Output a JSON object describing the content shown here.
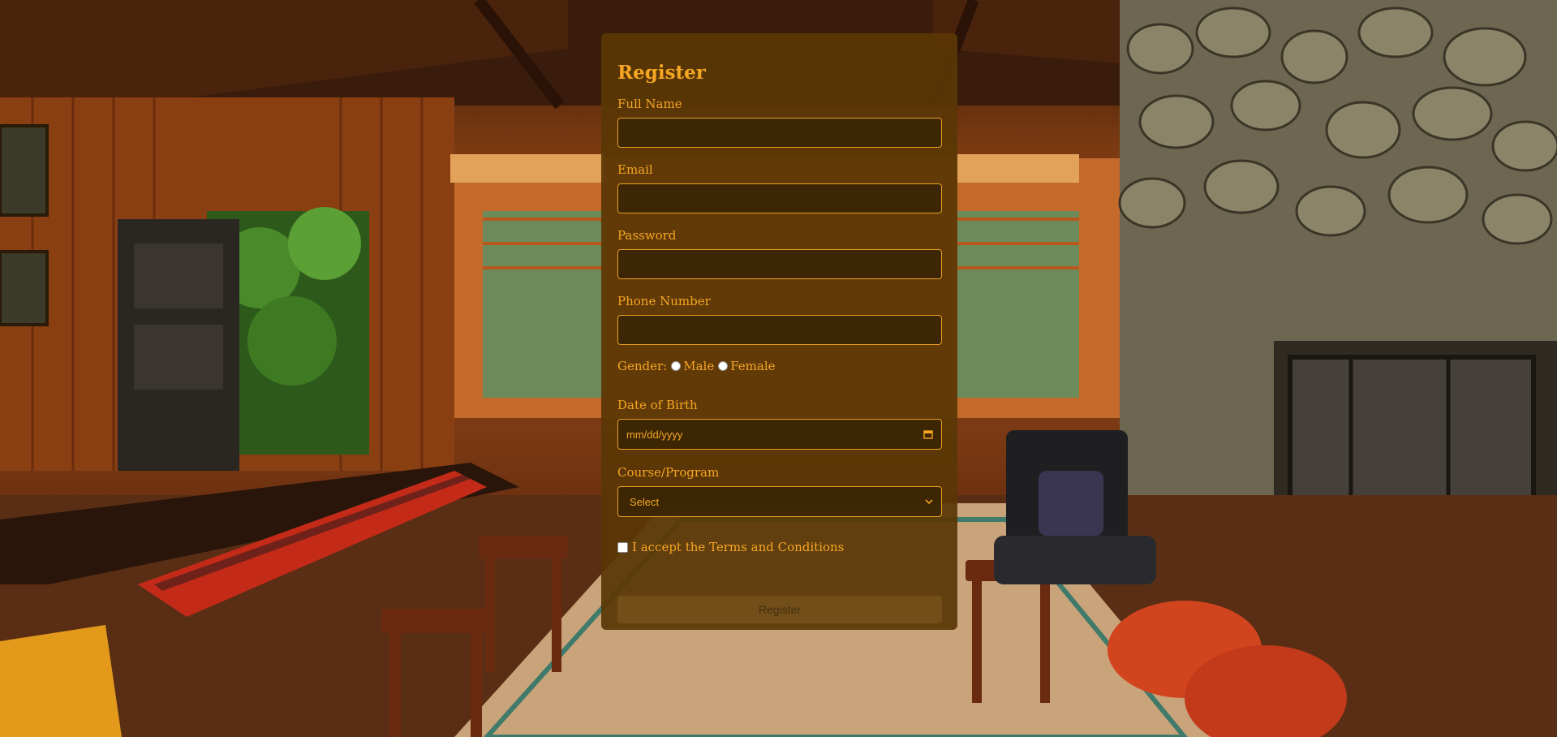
{
  "form": {
    "title": "Register",
    "full_name": {
      "label": "Full Name",
      "value": ""
    },
    "email": {
      "label": "Email",
      "value": ""
    },
    "password": {
      "label": "Password",
      "value": ""
    },
    "phone": {
      "label": "Phone Number",
      "value": ""
    },
    "gender": {
      "label": "Gender:",
      "options": [
        "Male",
        "Female"
      ]
    },
    "dob": {
      "label": "Date of Birth",
      "placeholder": "mm/dd/yyyy"
    },
    "course": {
      "label": "Course/Program",
      "selected": "Select"
    },
    "terms_label": "I accept the Terms and Conditions",
    "submit_label": "Register"
  },
  "colors": {
    "accent": "#f5a623",
    "card_bg": "#5a3705"
  },
  "icons": [
    "calendar-icon",
    "chevron-down-icon"
  ]
}
